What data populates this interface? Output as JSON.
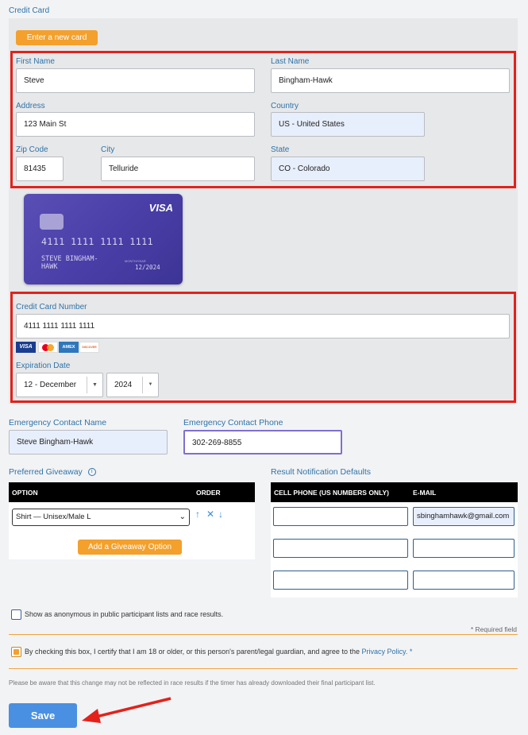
{
  "section_title": "Credit Card",
  "new_card_button": "Enter a new card",
  "billing": {
    "first_name_label": "First Name",
    "first_name_value": "Steve",
    "last_name_label": "Last Name",
    "last_name_value": "Bingham-Hawk",
    "address_label": "Address",
    "address_value": "123 Main St",
    "country_label": "Country",
    "country_value": "US - United States",
    "zip_label": "Zip Code",
    "zip_value": "81435",
    "city_label": "City",
    "city_value": "Telluride",
    "state_label": "State",
    "state_value": "CO - Colorado"
  },
  "card_preview": {
    "brand": "VISA",
    "number": "4111 1111 1111 1111",
    "name_line1": "STEVE BINGHAM-",
    "name_line2": "HAWK",
    "expiry": "12/2024",
    "valid_text": "MONTH/YEAR"
  },
  "card": {
    "number_label": "Credit Card Number",
    "number_value": "4111 1111 1111 1111",
    "brands": [
      "VISA",
      "mastercard",
      "AMEX",
      "DISCOVER"
    ],
    "expiration_label": "Expiration Date",
    "month_value": "12 - December",
    "year_value": "2024"
  },
  "emergency": {
    "name_label": "Emergency Contact Name",
    "name_value": "Steve Bingham-Hawk",
    "phone_label": "Emergency Contact Phone",
    "phone_value": "302-269-8855"
  },
  "giveaway": {
    "label": "Preferred Giveaway",
    "info_icon": "info-icon",
    "col_option": "OPTION",
    "col_order": "ORDER",
    "selected_option": "Shirt — Unisex/Male L",
    "add_button": "Add a Giveaway Option"
  },
  "notifications": {
    "label": "Result Notification Defaults",
    "col_phone": "CELL PHONE (US NUMBERS ONLY)",
    "col_email": "E-MAIL",
    "rows": [
      {
        "phone": "",
        "email": "sbinghamhawk@gmail.com"
      },
      {
        "phone": "",
        "email": ""
      },
      {
        "phone": "",
        "email": ""
      }
    ]
  },
  "anonymous_label": "Show as anonymous in public participant lists and race results.",
  "required_note": "* Required field",
  "certify": {
    "text": "By checking this box, I certify that I am 18 or older, or this person's parent/legal guardian, and agree to the",
    "link": "Privacy Policy.",
    "asterisk": "*",
    "checked": true
  },
  "disclaimer": "Please be aware that this change may not be reflected in race results if the timer has already downloaded their final participant list.",
  "save_button": "Save",
  "colors": {
    "accent_blue": "#2f73a8",
    "highlight_red": "#e2221b",
    "orange": "#f3a02c",
    "save_blue": "#4a90e2"
  }
}
